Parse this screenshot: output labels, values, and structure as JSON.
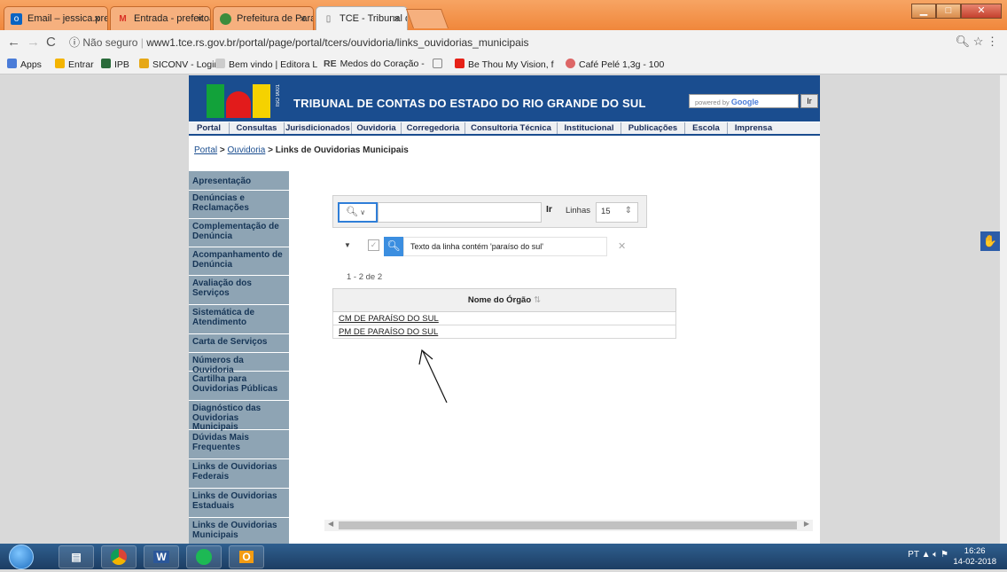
{
  "browser": {
    "tabs": [
      {
        "label": "Email – jessica.prefeitura:",
        "icon": "outlook-icon",
        "active": false
      },
      {
        "label": "Entrada - prefeitoarturlu:",
        "icon": "gmail-icon",
        "active": false
      },
      {
        "label": "Prefeitura de Paraíso do",
        "icon": "prefeitura-icon",
        "active": false
      },
      {
        "label": "TCE - Tribunal de Contas",
        "icon": "page-icon",
        "active": true
      }
    ],
    "security": "Não seguro",
    "url": "www1.tce.rs.gov.br/portal/page/portal/tcers/ouvidoria/links_ouvidorias_municipais",
    "bookmarks": [
      "Apps",
      "Entrar",
      "IPB",
      "SICONV - Login",
      "Bem vindo | Editora L",
      "Medos do Coração -",
      "",
      "Be Thou My Vision, f",
      "Café Pelé 1,3g - 100"
    ]
  },
  "site": {
    "title": "TRIBUNAL DE CONTAS DO ESTADO DO RIO GRANDE DO SUL",
    "iso": "ISO 9001",
    "google_placeholder": "powered by",
    "google_brand": "Google",
    "google_button": "Ir",
    "nav": [
      "Portal",
      "Consultas",
      "Jurisdicionados",
      "Ouvidoria",
      "Corregedoria",
      "Consultoria Técnica",
      "Institucional",
      "Publicações",
      "Escola",
      "Imprensa"
    ],
    "breadcrumb": {
      "portal": "Portal",
      "ouvidoria": "Ouvidoria",
      "current": "Links de Ouvidorias Municipais",
      "sep": ">"
    },
    "menu": [
      "Apresentação",
      "Denúncias e Reclamações",
      "Complementação de Denúncia",
      "Acompanhamento de Denúncia",
      "Avaliação dos Serviços",
      "Sistemática de Atendimento",
      "Carta de Serviços",
      "Números da Ouvidoria",
      "Cartilha para Ouvidorias Públicas",
      "Diagnóstico das Ouvidorias Municipais",
      "Dúvidas Mais Frequentes",
      "Links de Ouvidorias Federais",
      "Links de Ouvidorias Estaduais",
      "Links de Ouvidorias Municipais"
    ]
  },
  "report": {
    "search_value": "",
    "go_label": "Ir",
    "rows_label": "Linhas",
    "rows_value": "15",
    "filter_text": "Texto da linha contém 'paraíso do sul'",
    "counter": "1 - 2 de 2",
    "column_header": "Nome do Órgão",
    "rows": [
      "CM DE PARAÍSO DO SUL",
      "PM DE PARAÍSO DO SUL"
    ]
  },
  "taskbar": {
    "lang": "PT",
    "time": "16:26",
    "date": "14-02-2018"
  }
}
